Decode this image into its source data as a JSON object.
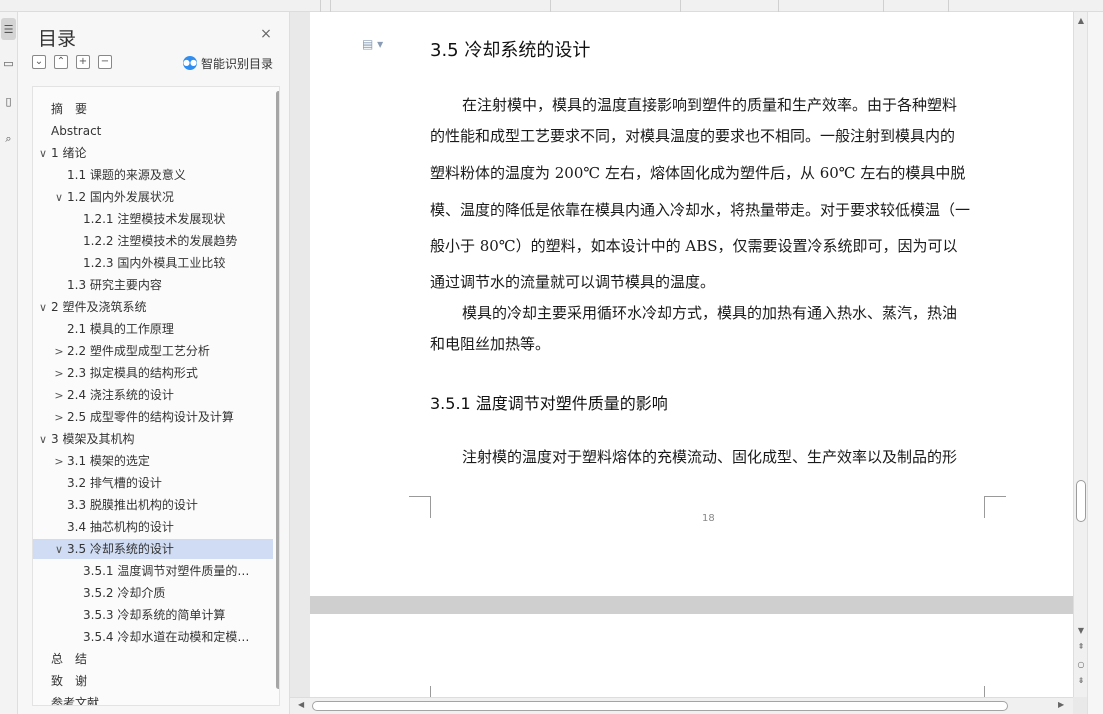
{
  "toc": {
    "title": "目录",
    "close_label": "×",
    "smart_label": "智能识别目录",
    "items": [
      {
        "label": "摘　要",
        "level": 0,
        "arrow": ""
      },
      {
        "label": "Abstract",
        "level": 0,
        "arrow": ""
      },
      {
        "label": "1 绪论",
        "level": 0,
        "arrow": "∨"
      },
      {
        "label": "1.1 课题的来源及意义",
        "level": 1,
        "arrow": ""
      },
      {
        "label": "1.2 国内外发展状况",
        "level": 1,
        "arrow": "∨"
      },
      {
        "label": "1.2.1 注塑模技术发展现状",
        "level": 2,
        "arrow": ""
      },
      {
        "label": "1.2.2 注塑模技术的发展趋势",
        "level": 2,
        "arrow": ""
      },
      {
        "label": "1.2.3 国内外模具工业比较",
        "level": 2,
        "arrow": ""
      },
      {
        "label": "1.3 研究主要内容",
        "level": 1,
        "arrow": ""
      },
      {
        "label": "2 塑件及浇筑系统",
        "level": 0,
        "arrow": "∨"
      },
      {
        "label": "2.1 模具的工作原理",
        "level": 1,
        "arrow": ""
      },
      {
        "label": "2.2 塑件成型成型工艺分析",
        "level": 1,
        "arrow": ">"
      },
      {
        "label": "2.3 拟定模具的结构形式",
        "level": 1,
        "arrow": ">"
      },
      {
        "label": "2.4 浇注系统的设计",
        "level": 1,
        "arrow": ">"
      },
      {
        "label": "2.5 成型零件的结构设计及计算",
        "level": 1,
        "arrow": ">"
      },
      {
        "label": "3 模架及其机构",
        "level": 0,
        "arrow": "∨"
      },
      {
        "label": "3.1 模架的选定",
        "level": 1,
        "arrow": ">"
      },
      {
        "label": "3.2 排气槽的设计",
        "level": 1,
        "arrow": ""
      },
      {
        "label": "3.3 脱膜推出机构的设计",
        "level": 1,
        "arrow": ""
      },
      {
        "label": "3.4 抽芯机构的设计",
        "level": 1,
        "arrow": ""
      },
      {
        "label": "3.5 冷却系统的设计",
        "level": 1,
        "arrow": "∨",
        "selected": true
      },
      {
        "label": "3.5.1 温度调节对塑件质量的…",
        "level": 2,
        "arrow": ""
      },
      {
        "label": "3.5.2 冷却介质",
        "level": 2,
        "arrow": ""
      },
      {
        "label": "3.5.3 冷却系统的简单计算",
        "level": 2,
        "arrow": ""
      },
      {
        "label": "3.5.4  冷却水道在动模和定模…",
        "level": 2,
        "arrow": ""
      },
      {
        "label": "总　结",
        "level": 0,
        "arrow": ""
      },
      {
        "label": "致　谢",
        "level": 0,
        "arrow": ""
      },
      {
        "label": "参考文献",
        "level": 0,
        "arrow": ""
      }
    ]
  },
  "doc": {
    "heading": "3.5 冷却系统的设计",
    "subheading": "3.5.1 温度调节对塑件质量的影响",
    "lines": [
      {
        "text": "在注射模中，模具的温度直接影响到塑件的质量和生产效率。由于各种塑料",
        "indent": true
      },
      {
        "text": "的性能和成型工艺要求不同，对模具温度的要求也不相同。一般注射到模具内的",
        "indent": false
      },
      {
        "text": "塑料粉体的温度为 200℃ 左右，熔体固化成为塑件后，从 60℃ 左右的模具中脱",
        "indent": false
      },
      {
        "text": "模、温度的降低是依靠在模具内通入冷却水，将热量带走。对于要求较低模温（一",
        "indent": false
      },
      {
        "text": "般小于 80℃）的塑料，如本设计中的 ABS，仅需要设置冷系统即可，因为可以",
        "indent": false
      },
      {
        "text": "通过调节水的流量就可以调节模具的温度。",
        "indent": false
      },
      {
        "text": "模具的冷却主要采用循环水冷却方式，模具的加热有通入热水、蒸汽，热油",
        "indent": true
      },
      {
        "text": "和电阻丝加热等。",
        "indent": false
      }
    ],
    "last_line": "注射模的温度对于塑料熔体的充模流动、固化成型、生产效率以及制品的形",
    "page_number": "18"
  },
  "icons": {
    "close": "close-icon",
    "smart": "smart-recognition-icon",
    "doc": "document-icon"
  }
}
